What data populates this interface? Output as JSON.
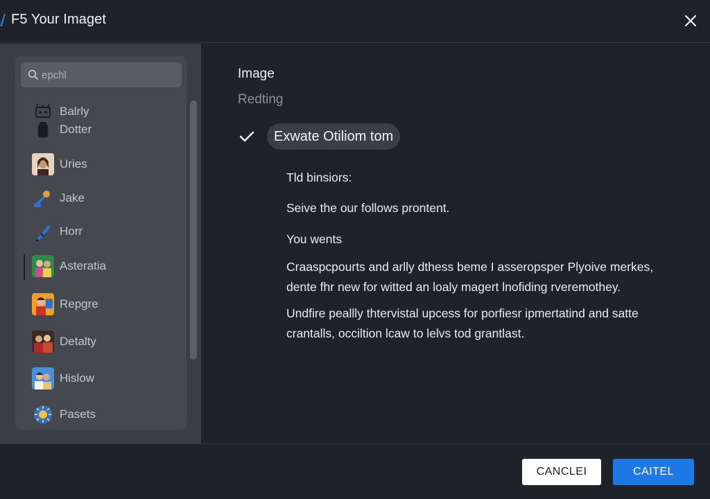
{
  "window": {
    "title": "F5 Your Imaget",
    "accent_color": "#1e78e6"
  },
  "search": {
    "placeholder": "epchl"
  },
  "sidebar": {
    "items": [
      {
        "label": "Balrly",
        "icon": "robot-icon"
      },
      {
        "label": "Dotter",
        "icon": "jar-icon"
      },
      {
        "label": "Uries",
        "icon": "portrait-icon"
      },
      {
        "label": "Jake",
        "icon": "wrench-icon"
      },
      {
        "label": "Horr",
        "icon": "pen-icon"
      },
      {
        "label": "Asteratia",
        "icon": "people-icon"
      },
      {
        "label": "Repgre",
        "icon": "person-icon"
      },
      {
        "label": "Detalty",
        "icon": "group-icon"
      },
      {
        "label": "Hislow",
        "icon": "couple-icon"
      },
      {
        "label": "Pasets",
        "icon": "sun-icon"
      }
    ]
  },
  "content": {
    "title": "Image",
    "subtitle": "Redting",
    "selected_option": "Exwate Otiliom tom",
    "lines": [
      "Tld binsiors:",
      "Seive the our follows prontent.",
      "You wents"
    ],
    "paragraph1": "Craaspcpourts and arlly dthess beme I asseropsper Plyoive merkes, dente fhr new for witted an loaly magert lnofiding rveremothey.",
    "paragraph2": "Undfire peallly thtervistal upcess for porfiesr ipmertatind and satte crantalls, occiltion lcaw to lelvs tod grantlast."
  },
  "footer": {
    "cancel_label": "CANCLEI",
    "primary_label": "CAITEL"
  }
}
